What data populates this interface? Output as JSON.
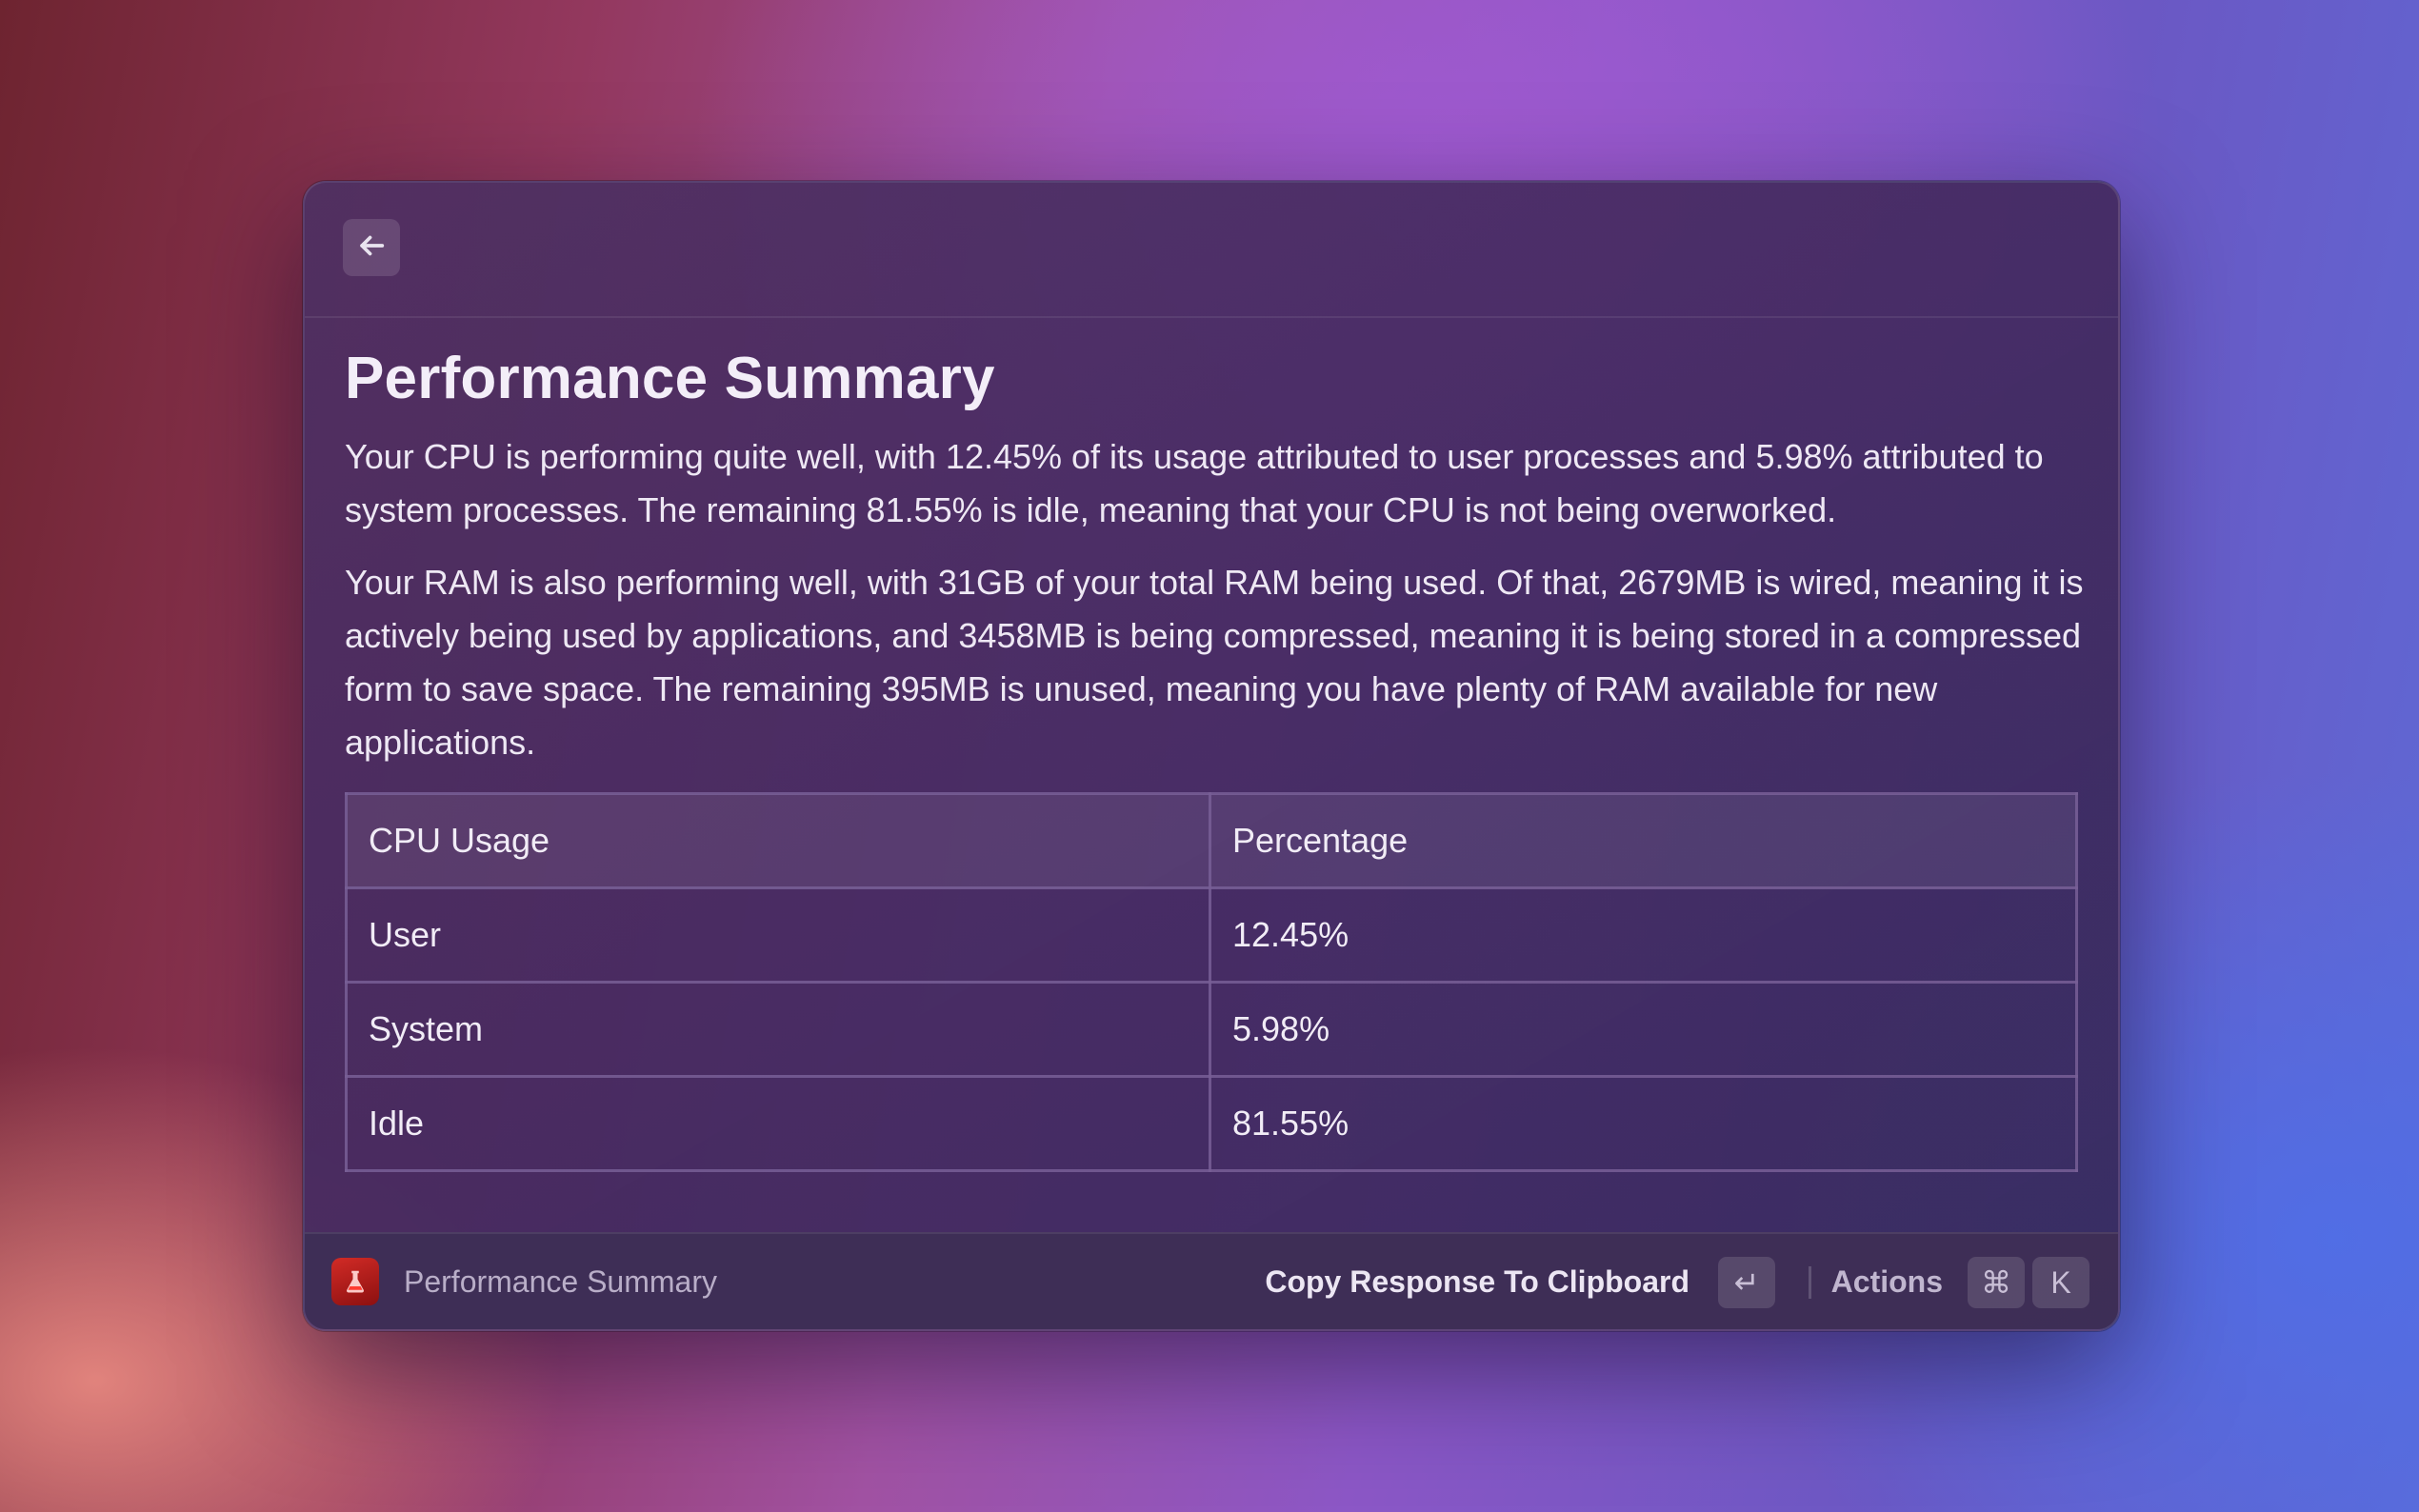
{
  "header": {
    "back_icon": "arrow-left-icon"
  },
  "main": {
    "title": "Performance Summary",
    "paragraphs": [
      "Your CPU is performing quite well, with 12.45% of its usage attributed to user processes and 5.98% attributed to system processes. The remaining 81.55% is idle, meaning that your CPU is not being overworked.",
      "Your RAM is also performing well, with 31GB of your total RAM being used. Of that, 2679MB is wired, meaning it is actively being used by applications, and 3458MB is being compressed, meaning it is being stored in a compressed form to save space. The remaining 395MB is unused, meaning you have plenty of RAM available for new applications."
    ],
    "table": {
      "headers": [
        "CPU Usage",
        "Percentage"
      ],
      "rows": [
        [
          "User",
          "12.45%"
        ],
        [
          "System",
          "5.98%"
        ],
        [
          "Idle",
          "81.55%"
        ]
      ]
    }
  },
  "footer": {
    "app_icon": "flask-icon",
    "title": "Performance Summary",
    "primary_action": "Copy Response To Clipboard",
    "primary_shortcut": "↵",
    "actions_label": "Actions",
    "actions_shortcut": [
      "⌘",
      "K"
    ]
  },
  "colors": {
    "app_icon_bg": "#c8221e",
    "window_bg": "#4a2f62",
    "footer_bg": "#3e2e56"
  }
}
